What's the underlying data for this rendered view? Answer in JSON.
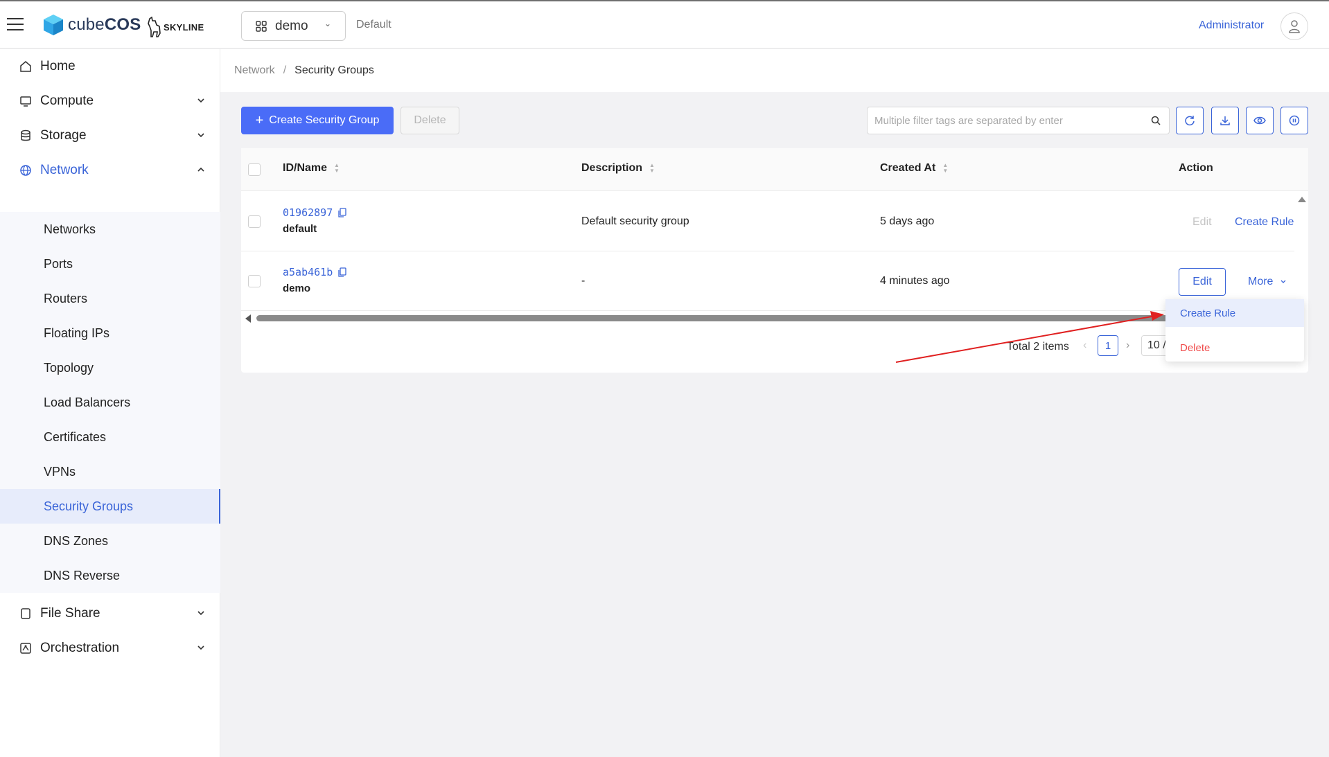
{
  "header": {
    "brand_prefix": "cube",
    "brand_suffix": "COS",
    "brand_partner": "SKYLINE",
    "project": "demo",
    "domain": "Default",
    "user": "Administrator"
  },
  "sidebar": {
    "items": [
      {
        "label": "Home",
        "icon": "home-icon"
      },
      {
        "label": "Compute",
        "icon": "monitor-icon"
      },
      {
        "label": "Storage",
        "icon": "database-icon"
      },
      {
        "label": "Network",
        "icon": "globe-icon"
      },
      {
        "label": "File Share",
        "icon": "file-icon"
      },
      {
        "label": "Orchestration",
        "icon": "orchestration-icon"
      }
    ],
    "network_children": [
      "Networks",
      "Ports",
      "Routers",
      "Floating IPs",
      "Topology",
      "Load Balancers",
      "Certificates",
      "VPNs",
      "Security Groups",
      "DNS Zones",
      "DNS Reverse"
    ],
    "selected": "Security Groups"
  },
  "breadcrumb": {
    "parent": "Network",
    "separator": "/",
    "current": "Security Groups"
  },
  "toolbar": {
    "create_label": "Create Security Group",
    "delete_label": "Delete",
    "search_placeholder": "Multiple filter tags are separated by enter"
  },
  "table": {
    "columns": [
      "ID/Name",
      "Description",
      "Created At",
      "Action"
    ],
    "rows": [
      {
        "id": "01962897",
        "name": "default",
        "description": "Default security group",
        "created": "5 days ago",
        "actions": [
          "Edit",
          "Create Rule"
        ]
      },
      {
        "id": "a5ab461b",
        "name": "demo",
        "description": "-",
        "created": "4 minutes ago",
        "actions": [
          "Edit",
          "More"
        ]
      }
    ]
  },
  "pagination": {
    "total": "Total 2 items",
    "current": "1",
    "page_size": "10 /"
  },
  "dropdown": {
    "items": [
      "Create Rule",
      "Delete"
    ]
  },
  "colors": {
    "accent": "#3a64d8",
    "primary_button": "#4a6cf7",
    "danger": "#f04b4b",
    "annotation_arrow": "#e02020"
  }
}
